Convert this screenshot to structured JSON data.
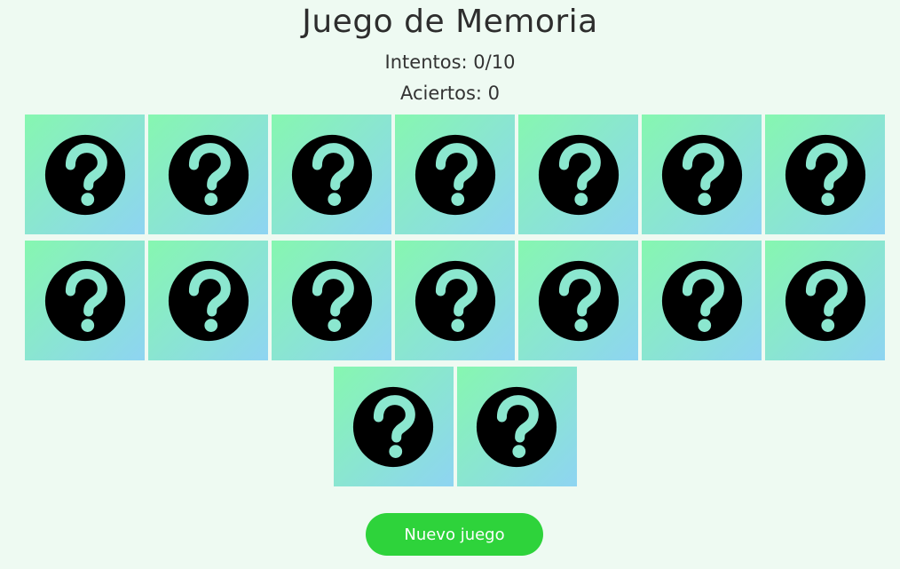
{
  "game": {
    "title": "Juego de Memoria",
    "attempts_text": "Intentos: 0/10",
    "hits_text": "Aciertos: 0"
  },
  "board": {
    "rows": [
      7,
      7,
      2
    ],
    "card_state": "face-down",
    "card_back_icon": "question-circle-icon",
    "card_gradient": [
      "#86f7b0",
      "#8ed4f2"
    ]
  },
  "actions": {
    "new_game_label": "Nuevo juego"
  },
  "colors": {
    "background": "#eefaf2",
    "button": "#2ed33b",
    "icon_fill": "#000000",
    "icon_mark": "#8be7cf"
  }
}
